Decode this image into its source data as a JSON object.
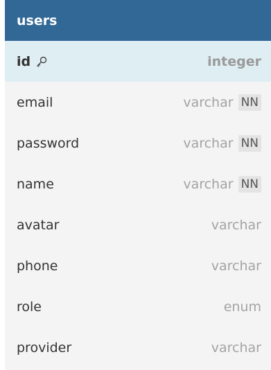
{
  "table": {
    "title": "users",
    "pk": {
      "name": "id",
      "type": "integer",
      "icon": "key-icon"
    },
    "columns": [
      {
        "name": "email",
        "type": "varchar",
        "badge": "NN"
      },
      {
        "name": "password",
        "type": "varchar",
        "badge": "NN"
      },
      {
        "name": "name",
        "type": "varchar",
        "badge": "NN"
      },
      {
        "name": "avatar",
        "type": "varchar"
      },
      {
        "name": "phone",
        "type": "varchar"
      },
      {
        "name": "role",
        "type": "enum"
      },
      {
        "name": "provider",
        "type": "varchar"
      }
    ]
  },
  "colors": {
    "header": "#316896",
    "pk_row": "#dfeef3",
    "row": "#f4f4f4"
  }
}
